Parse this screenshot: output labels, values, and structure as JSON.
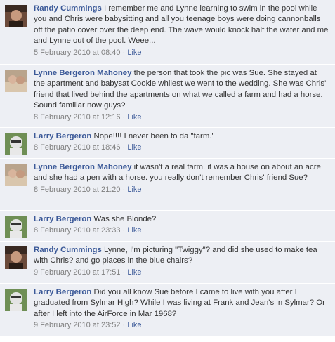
{
  "comments": [
    {
      "author": "Randy Cummings",
      "text": "I remember me and Lynne learning to swim in the pool while you and Chris were babysitting and all you teenage boys were doing cannonballs off the patio cover over the deep end. The wave would knock half the water and me and Lynne out of the pool. Weee...",
      "timestamp": "5 February 2010 at 08:40",
      "like_label": "Like",
      "avatar": "randy-avatar"
    },
    {
      "author": "Lynne Bergeron Mahoney",
      "text": "the person that took the pic was Sue. She stayed at the apartment and babysat Cookie whilest we went to the wedding. She was Chris' friend that lived behind the apartments on what we called a farm and had a horse. Sound familiar now guys?",
      "timestamp": "8 February 2010 at 12:16",
      "like_label": "Like",
      "avatar": "lynne-avatar"
    },
    {
      "author": "Larry Bergeron",
      "text": "Nope!!!! I never been to da \"farm.\"",
      "timestamp": "8 February 2010 at 18:46",
      "like_label": "Like",
      "avatar": "larry-avatar"
    },
    {
      "author": "Lynne Bergeron Mahoney",
      "text": "it wasn't a real farm. it was a house on about an acre and she had a pen with a horse. you really don't remember Chris' friend Sue?",
      "timestamp": "8 February 2010 at 21:20",
      "like_label": "Like",
      "avatar": "lynne-avatar"
    },
    {
      "author": "Larry Bergeron",
      "text": "Was she Blonde?",
      "timestamp": "8 February 2010 at 23:33",
      "like_label": "Like",
      "avatar": "larry-avatar"
    },
    {
      "author": "Randy Cummings",
      "text": "Lynne, I'm picturing \"Twiggy\"? and did she used to make tea with Chris? and go places in the blue chairs?",
      "timestamp": "9 February 2010 at 17:51",
      "like_label": "Like",
      "avatar": "randy-avatar"
    },
    {
      "author": "Larry Bergeron",
      "text": "Did you all know Sue before I came to live with you after I graduated from Sylmar High? While I was living at Frank and Jean's in Sylmar? Or after I left into the AirForce in Mar 1968?",
      "timestamp": "9 February 2010 at 23:52",
      "like_label": "Like",
      "avatar": "larry-avatar"
    }
  ]
}
